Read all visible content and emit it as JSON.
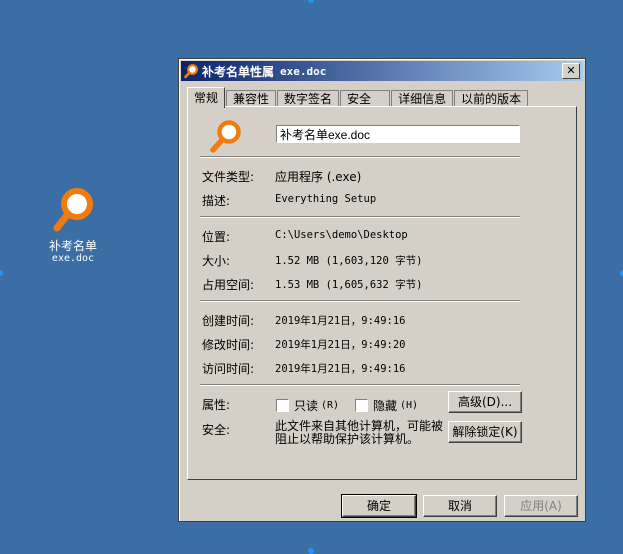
{
  "desktop": {
    "icon_label_line1": "补考名单",
    "icon_label_line2": "exe.doc"
  },
  "dialog": {
    "title": "补考名单性属",
    "title_suffix": "exe.doc",
    "close_glyph": "✕",
    "tabs": [
      "常规",
      "兼容性",
      "数字签名",
      "安全",
      "详细信息",
      "以前的版本"
    ],
    "file_name_value": "补考名单exe.doc",
    "labels": {
      "type": "文件类型:",
      "description": "描述:",
      "location": "位置:",
      "size": "大小:",
      "size_on_disk": "占用空间:",
      "created": "创建时间:",
      "modified": "修改时间:",
      "accessed": "访问时间:",
      "attributes": "属性:",
      "security": "安全:"
    },
    "values": {
      "type": "应用程序 (.exe)",
      "description": "Everything Setup",
      "location": "C:\\Users\\demo\\Desktop",
      "size": "1.52 MB (1,603,120 字节)",
      "size_on_disk": "1.53 MB (1,605,632 字节)",
      "created": "2019年1月21日，9:49:16",
      "modified": "2019年1月21日，9:49:20",
      "accessed": "2019年1月21日，9:49:16"
    },
    "readonly_label": "只读",
    "readonly_accel": "(R)",
    "hidden_label": "隐藏",
    "hidden_accel": "(H)",
    "advanced_button": "高级(D)...",
    "security_text": "此文件来自其他计算机，可能被阻止以帮助保护该计算机。",
    "unblock_button": "解除锁定(K)",
    "ok_button": "确定",
    "cancel_button": "取消",
    "apply_button": "应用(A)"
  },
  "colors": {
    "desktop": "#3a6ea5",
    "dialog_face": "#d4d0c8",
    "titlebar_start": "#0a246a",
    "titlebar_end": "#a6caf0",
    "icon_orange": "#f07c0f"
  },
  "icons": {
    "file_icon": "magnifier-icon"
  }
}
